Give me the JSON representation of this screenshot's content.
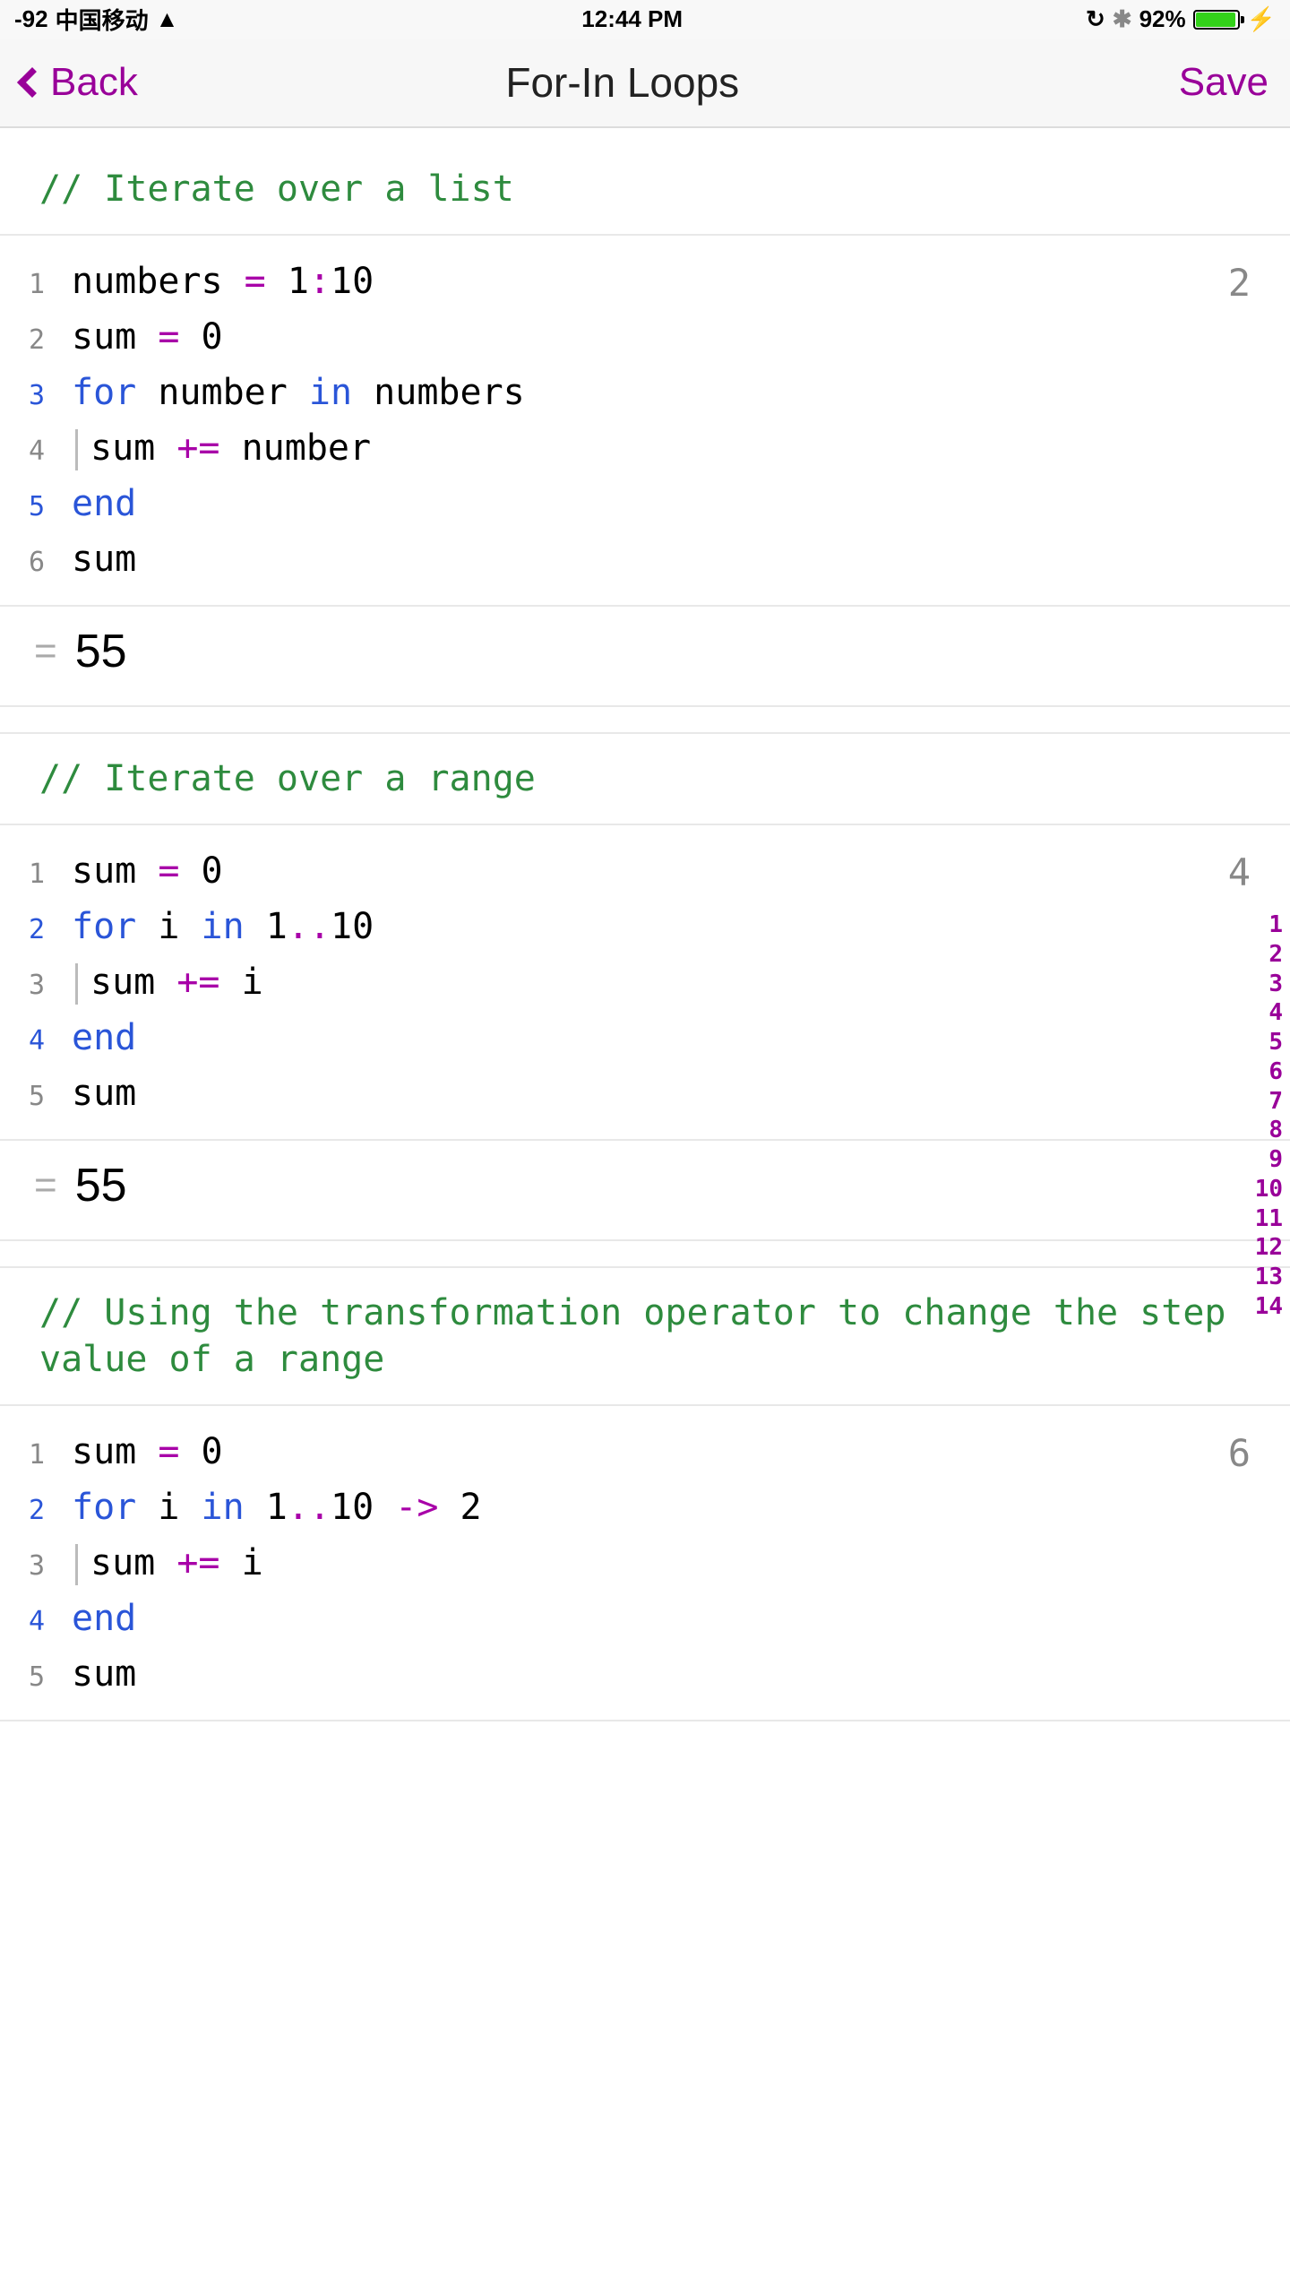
{
  "status": {
    "signal": "-92",
    "carrier": "中国移动",
    "time": "12:44 PM",
    "battery_pct": "92%"
  },
  "nav": {
    "back_label": "Back",
    "title": "For-In Loops",
    "save_label": "Save"
  },
  "blocks": [
    {
      "comment": "// Iterate over a list",
      "badge": "2",
      "lines": [
        {
          "n": "1",
          "kw": false,
          "indent": false,
          "tokens": [
            {
              "t": "numbers ",
              "c": ""
            },
            {
              "t": "=",
              "c": "op"
            },
            {
              "t": " 1",
              "c": ""
            },
            {
              "t": ":",
              "c": "op"
            },
            {
              "t": "10",
              "c": ""
            }
          ]
        },
        {
          "n": "2",
          "kw": false,
          "indent": false,
          "tokens": [
            {
              "t": "sum ",
              "c": ""
            },
            {
              "t": "=",
              "c": "op"
            },
            {
              "t": " 0",
              "c": ""
            }
          ]
        },
        {
          "n": "3",
          "kw": true,
          "indent": false,
          "tokens": [
            {
              "t": "for",
              "c": "k"
            },
            {
              "t": " number ",
              "c": ""
            },
            {
              "t": "in",
              "c": "k"
            },
            {
              "t": " numbers",
              "c": ""
            }
          ]
        },
        {
          "n": "4",
          "kw": false,
          "indent": true,
          "tokens": [
            {
              "t": "sum ",
              "c": ""
            },
            {
              "t": "+=",
              "c": "op"
            },
            {
              "t": " number",
              "c": ""
            }
          ]
        },
        {
          "n": "5",
          "kw": true,
          "indent": false,
          "tokens": [
            {
              "t": "end",
              "c": "k"
            }
          ]
        },
        {
          "n": "6",
          "kw": false,
          "indent": false,
          "tokens": [
            {
              "t": "sum",
              "c": ""
            }
          ]
        }
      ],
      "result": "55"
    },
    {
      "comment": "// Iterate over a range",
      "badge": "4",
      "lines": [
        {
          "n": "1",
          "kw": false,
          "indent": false,
          "tokens": [
            {
              "t": "sum ",
              "c": ""
            },
            {
              "t": "=",
              "c": "op"
            },
            {
              "t": " 0",
              "c": ""
            }
          ]
        },
        {
          "n": "2",
          "kw": true,
          "indent": false,
          "tokens": [
            {
              "t": "for",
              "c": "k"
            },
            {
              "t": " i ",
              "c": ""
            },
            {
              "t": "in",
              "c": "k"
            },
            {
              "t": " 1",
              "c": ""
            },
            {
              "t": "..",
              "c": "op"
            },
            {
              "t": "10",
              "c": ""
            }
          ]
        },
        {
          "n": "3",
          "kw": false,
          "indent": true,
          "tokens": [
            {
              "t": "sum ",
              "c": ""
            },
            {
              "t": "+=",
              "c": "op"
            },
            {
              "t": " i",
              "c": ""
            }
          ]
        },
        {
          "n": "4",
          "kw": true,
          "indent": false,
          "tokens": [
            {
              "t": "end",
              "c": "k"
            }
          ]
        },
        {
          "n": "5",
          "kw": false,
          "indent": false,
          "tokens": [
            {
              "t": "sum",
              "c": ""
            }
          ]
        }
      ],
      "result": "55"
    },
    {
      "comment": "// Using the transformation operator to change the step value of a range",
      "badge": "6",
      "lines": [
        {
          "n": "1",
          "kw": false,
          "indent": false,
          "tokens": [
            {
              "t": "sum ",
              "c": ""
            },
            {
              "t": "=",
              "c": "op"
            },
            {
              "t": " 0",
              "c": ""
            }
          ]
        },
        {
          "n": "2",
          "kw": true,
          "indent": false,
          "tokens": [
            {
              "t": "for",
              "c": "k"
            },
            {
              "t": " i ",
              "c": ""
            },
            {
              "t": "in",
              "c": "k"
            },
            {
              "t": " 1",
              "c": ""
            },
            {
              "t": "..",
              "c": "op"
            },
            {
              "t": "10 ",
              "c": ""
            },
            {
              "t": "->",
              "c": "op"
            },
            {
              "t": " 2",
              "c": ""
            }
          ]
        },
        {
          "n": "3",
          "kw": false,
          "indent": true,
          "tokens": [
            {
              "t": "sum ",
              "c": ""
            },
            {
              "t": "+=",
              "c": "op"
            },
            {
              "t": " i",
              "c": ""
            }
          ]
        },
        {
          "n": "4",
          "kw": true,
          "indent": false,
          "tokens": [
            {
              "t": "end",
              "c": "k"
            }
          ]
        },
        {
          "n": "5",
          "kw": false,
          "indent": false,
          "tokens": [
            {
              "t": "sum",
              "c": ""
            }
          ]
        }
      ],
      "result": null
    }
  ],
  "side_ruler": [
    "1",
    "2",
    "3",
    "4",
    "5",
    "6",
    "7",
    "8",
    "9",
    "10",
    "11",
    "12",
    "13",
    "14"
  ]
}
